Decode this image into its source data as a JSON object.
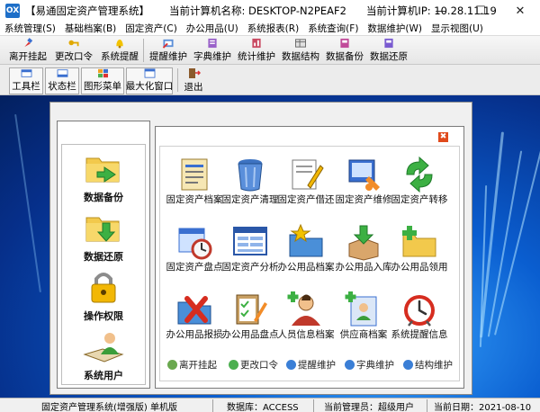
{
  "window": {
    "title": "【易通固定资产管理系统】",
    "host_label": "当前计算机名称: DESKTOP-N2PEAF2",
    "ip_label": "当前计算机IP: 10.28.11.19",
    "app_icon_text": "OX",
    "minimize_glyph": "—",
    "maximize_glyph": "☐",
    "close_glyph": "✕"
  },
  "menubar": {
    "items": [
      {
        "label": "系统管理(S)"
      },
      {
        "label": "基础档案(B)"
      },
      {
        "label": "固定资产(C)"
      },
      {
        "label": "办公用品(U)"
      },
      {
        "label": "系统报表(R)"
      },
      {
        "label": "系统查询(F)"
      },
      {
        "label": "数据维护(W)"
      },
      {
        "label": "显示视图(U)"
      }
    ]
  },
  "toolbar": {
    "items": [
      {
        "label": "离开挂起",
        "icon": "pin-icon"
      },
      {
        "label": "更改口令",
        "icon": "key-icon"
      },
      {
        "label": "系统提醒",
        "icon": "bell-icon"
      },
      {
        "label": "提醒维护",
        "icon": "reminder-icon"
      },
      {
        "label": "字典维护",
        "icon": "dictionary-icon"
      },
      {
        "label": "统计维护",
        "icon": "stats-icon"
      },
      {
        "label": "数据结构",
        "icon": "structure-icon"
      },
      {
        "label": "数据备份",
        "icon": "backup-icon"
      },
      {
        "label": "数据还原",
        "icon": "restore-icon"
      }
    ]
  },
  "view_toolbar": {
    "items": [
      {
        "label": "工具栏",
        "icon": "toolbar-icon"
      },
      {
        "label": "状态栏",
        "icon": "statusbar-icon"
      },
      {
        "label": "图形菜单",
        "icon": "graphic-menu-icon"
      },
      {
        "label": "最大化窗口",
        "icon": "maximize-window-icon"
      },
      {
        "label": "退出",
        "icon": "exit-icon"
      }
    ]
  },
  "sidebar": {
    "items": [
      {
        "label": "数据备份",
        "icon": "folder-backup-icon"
      },
      {
        "label": "数据还原",
        "icon": "folder-restore-icon"
      },
      {
        "label": "操作权限",
        "icon": "lock-icon"
      },
      {
        "label": "系统用户",
        "icon": "user-book-icon"
      }
    ]
  },
  "close_panel_glyph": "✖",
  "grid": {
    "items": [
      {
        "label": "固定资产档案",
        "icon": "asset-file-icon"
      },
      {
        "label": "固定资产清理",
        "icon": "trash-icon"
      },
      {
        "label": "固定资产借还",
        "icon": "lend-return-icon"
      },
      {
        "label": "固定资产维修",
        "icon": "repair-icon"
      },
      {
        "label": "固定资产转移",
        "icon": "transfer-icon"
      },
      {
        "label": "固定资产盘点",
        "icon": "inventory-clock-icon"
      },
      {
        "label": "固定资产分析",
        "icon": "analysis-icon"
      },
      {
        "label": "办公用品档案",
        "icon": "office-file-icon"
      },
      {
        "label": "办公用品入库",
        "icon": "stock-in-icon"
      },
      {
        "label": "办公用品领用",
        "icon": "office-use-icon"
      },
      {
        "label": "办公用品报损",
        "icon": "damage-icon"
      },
      {
        "label": "办公用品盘点",
        "icon": "office-inventory-icon"
      },
      {
        "label": "人员信息档案",
        "icon": "staff-icon"
      },
      {
        "label": "供应商档案",
        "icon": "supplier-icon"
      },
      {
        "label": "系统提醒信息",
        "icon": "alarm-clock-icon"
      }
    ]
  },
  "quick_links": [
    {
      "label": "离开挂起",
      "color": "#6aa84f"
    },
    {
      "label": "更改口令",
      "color": "#4caf50"
    },
    {
      "label": "提醒维护",
      "color": "#3b7fd6"
    },
    {
      "label": "字典维护",
      "color": "#3b7fd6"
    },
    {
      "label": "结构维护",
      "color": "#3b7fd6"
    }
  ],
  "statusbar": {
    "system": "固定资产管理系统(增强版) 单机版",
    "database": "数据库：ACCESS",
    "admin": "当前管理员：超级用户",
    "date": "当前日期：2021-08-10"
  },
  "colors": {
    "desktop_blue": "#0a5ed0",
    "accent_orange": "#e04a1c"
  }
}
